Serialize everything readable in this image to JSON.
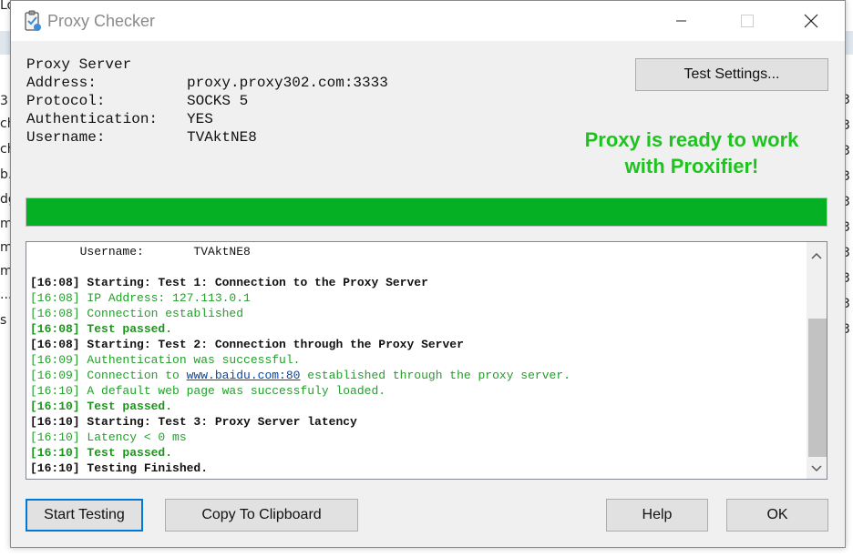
{
  "background_window": {
    "left_fragments": [
      "Lo",
      "",
      "",
      "3",
      "ch",
      "ch",
      "b.",
      "dg",
      "m",
      "m",
      "m",
      "...",
      "s",
      "",
      "",
      "",
      "",
      "",
      "",
      "",
      "",
      ""
    ],
    "right_fragments": [
      "3",
      "3",
      "3",
      "3",
      "3",
      "3",
      "3",
      "3",
      "3",
      "3"
    ]
  },
  "window": {
    "title": "Proxy Checker",
    "icon": "clipboard-check-icon"
  },
  "proxy_info": {
    "heading": "Proxy Server",
    "address_label": "Address:",
    "address_value": "proxy.proxy302.com:3333",
    "protocol_label": "Protocol:",
    "protocol_value": "SOCKS 5",
    "auth_label": "Authentication:",
    "auth_value": "YES",
    "username_label": "Username:",
    "username_value": "TVAktNE8"
  },
  "buttons": {
    "test_settings": "Test Settings...",
    "start_testing": "Start Testing",
    "copy_clipboard": "Copy To Clipboard",
    "help": "Help",
    "ok": "OK"
  },
  "status": {
    "line1": "Proxy is ready to work",
    "line2": "with Proxifier!",
    "color": "#1ec41e"
  },
  "progress": {
    "percent": 100,
    "color": "#06b025"
  },
  "log": {
    "lines": [
      {
        "text": "       Username:       TVAktNE8",
        "style": "plain"
      },
      {
        "text": "",
        "style": "plain"
      },
      {
        "text": "[16:08] Starting: Test 1: Connection to the Proxy Server",
        "style": "bold"
      },
      {
        "text": "[16:08] IP Address: 127.113.0.1",
        "style": "green"
      },
      {
        "text": "[16:08] Connection established",
        "style": "green"
      },
      {
        "text": "[16:08] Test passed.",
        "style": "green-bold"
      },
      {
        "text": "[16:08] Starting: Test 2: Connection through the Proxy Server",
        "style": "bold"
      },
      {
        "text": "[16:09] Authentication was successful.",
        "style": "green"
      },
      {
        "text_before": "[16:09] Connection to ",
        "link": "www.baidu.com:80",
        "text_after": " established through the proxy server.",
        "style": "green"
      },
      {
        "text": "[16:10] A default web page was successfuly loaded.",
        "style": "green"
      },
      {
        "text": "[16:10] Test passed.",
        "style": "green-bold"
      },
      {
        "text": "[16:10] Starting: Test 3: Proxy Server latency",
        "style": "bold"
      },
      {
        "text": "[16:10] Latency < 0 ms",
        "style": "green"
      },
      {
        "text": "[16:10] Test passed.",
        "style": "green-bold"
      },
      {
        "text": "[16:10] Testing Finished.",
        "style": "bold"
      }
    ]
  }
}
